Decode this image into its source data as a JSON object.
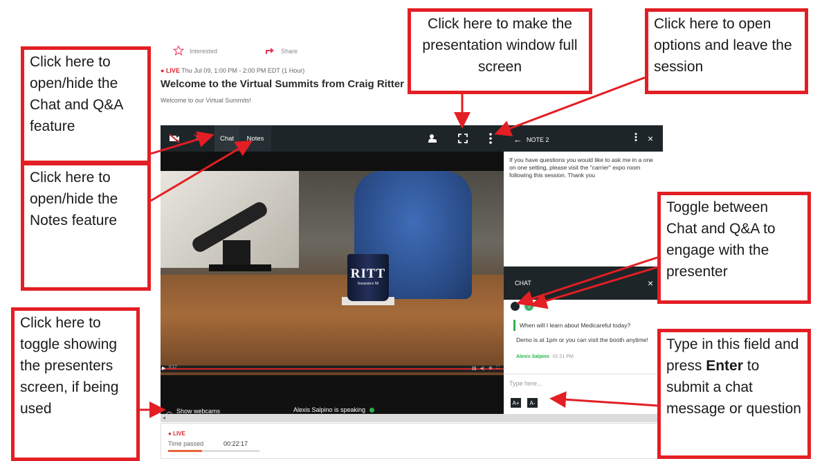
{
  "header": {
    "interested_label": "Interested",
    "share_label": "Share",
    "live_badge": "LIVE",
    "schedule": "Thu Jul 09, 1:00 PM - 2:00 PM",
    "timezone": "EDT",
    "duration": "(1 Hour)",
    "title": "Welcome to the Virtual Summits from Craig Ritter",
    "subtitle": "Welcome to our Virtual Summits!"
  },
  "toolbar": {
    "tabs": [
      "Chat",
      "Notes"
    ]
  },
  "video": {
    "mug_text": "RITT",
    "mug_subtext": "Insurance M",
    "time_left": "0:17",
    "show_webcams_label": "Show webcams",
    "speaking_label": "Alexis Salpino is speaking"
  },
  "notes": {
    "title": "NOTE 2",
    "body": "If you have questions you would like to ask me in a one on one setting, please visit the \"carrier\" expo room following this session. Thank you"
  },
  "chat": {
    "title": "CHAT",
    "question": "When will I learn about Medicareful today?",
    "answer": "Demo is at 1pm or you can visit the booth anytime!",
    "author": "Alexis Salpino",
    "time": "01:21 PM",
    "input_placeholder": "Type here...",
    "font_up": "A+",
    "font_down": "A-"
  },
  "footer": {
    "live_badge": "LIVE",
    "time_passed_label": "Time passed",
    "time_passed_value": "00:22:17",
    "time_passed_fraction": 0.37
  },
  "callouts": {
    "chat_qa": "Click here to open/hide the Chat and Q&A feature",
    "notes": "Click here to open/hide the Notes feature",
    "toggle_screen": "Click here to toggle showing the presenters screen, if being used",
    "fullscreen": "Click here to make the presentation window full screen",
    "options": "Click here to open options and leave the session",
    "toggle_chat": "Toggle between Chat and Q&A to engage with the presenter",
    "type_pre": "Type in this field and press",
    "type_key": "Enter",
    "type_post": "to submit a chat message or question"
  },
  "colors": {
    "accent_red": "#e31e24",
    "live_red": "#d9252a",
    "dark_bar": "#1e2528",
    "speaking_green": "#2bb34b"
  }
}
